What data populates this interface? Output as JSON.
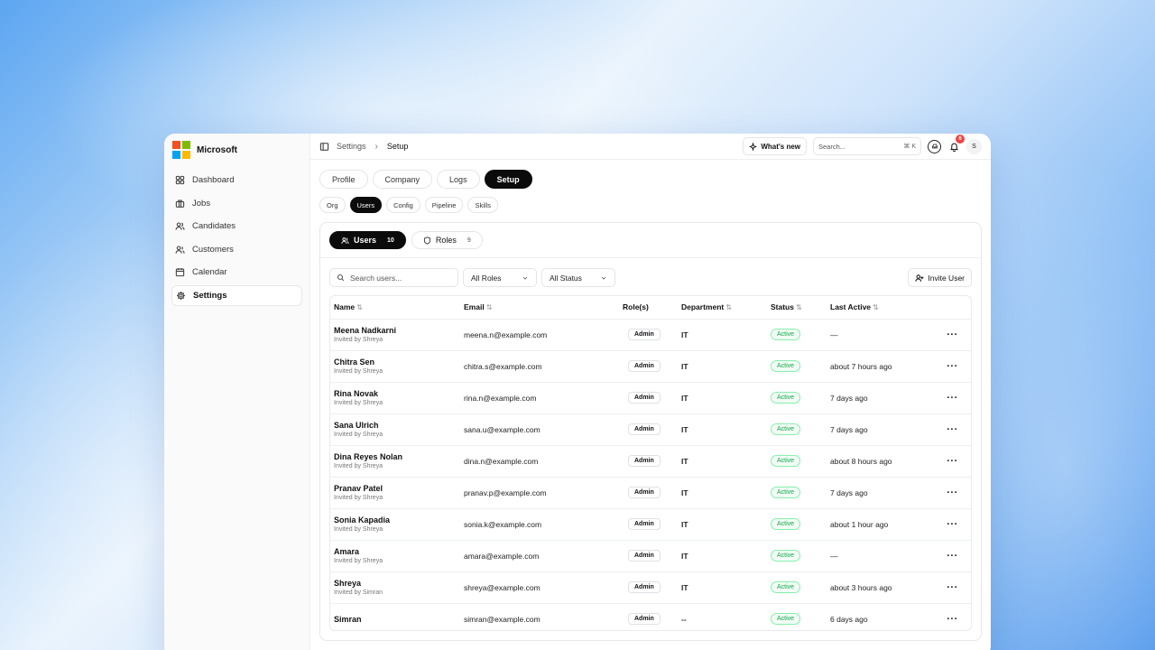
{
  "brand": {
    "name": "Microsoft",
    "logo_colors": [
      "#f25022",
      "#7fba00",
      "#00a4ef",
      "#ffb900"
    ]
  },
  "sidebar": {
    "items": [
      {
        "label": "Dashboard",
        "icon": "dashboard-icon",
        "active": false
      },
      {
        "label": "Jobs",
        "icon": "briefcase-icon",
        "active": false
      },
      {
        "label": "Candidates",
        "icon": "users-icon",
        "active": false
      },
      {
        "label": "Customers",
        "icon": "user-card-icon",
        "active": false
      },
      {
        "label": "Calendar",
        "icon": "calendar-icon",
        "active": false
      },
      {
        "label": "Settings",
        "icon": "gear-icon",
        "active": true
      }
    ]
  },
  "topbar": {
    "breadcrumb": [
      "Settings",
      "Setup"
    ],
    "whats_new": "What's new",
    "search_placeholder": "Search...",
    "search_shortcut": "⌘ K",
    "notification_count": "6",
    "avatar_initial": "S"
  },
  "tabs": [
    "Profile",
    "Company",
    "Logs",
    "Setup"
  ],
  "active_tab": "Setup",
  "subtabs": [
    "Org",
    "Users",
    "Config",
    "Pipeline",
    "Skills"
  ],
  "active_subtab": "Users",
  "panel": {
    "segments": [
      {
        "label": "Users",
        "count": "10",
        "icon": "users-icon",
        "active": true
      },
      {
        "label": "Roles",
        "count": "9",
        "icon": "shield-icon",
        "active": false
      }
    ],
    "search_placeholder": "Search users...",
    "role_filter": "All Roles",
    "status_filter": "All Status",
    "invite_label": "Invite User"
  },
  "table": {
    "columns": [
      "Name",
      "Email",
      "Role(s)",
      "Department",
      "Status",
      "Last Active"
    ],
    "rows": [
      {
        "name": "Meena Nadkarni",
        "invited": "Invited by Shreya",
        "email": "meena.n@example.com",
        "role": "Admin",
        "dept": "IT",
        "status": "Active",
        "last": "—"
      },
      {
        "name": "Chitra Sen",
        "invited": "Invited by Shreya",
        "email": "chitra.s@example.com",
        "role": "Admin",
        "dept": "IT",
        "status": "Active",
        "last": "about 7 hours ago"
      },
      {
        "name": "Rina Novak",
        "invited": "Invited by Shreya",
        "email": "rina.n@example.com",
        "role": "Admin",
        "dept": "IT",
        "status": "Active",
        "last": "7 days ago"
      },
      {
        "name": "Sana Ulrich",
        "invited": "Invited by Shreya",
        "email": "sana.u@example.com",
        "role": "Admin",
        "dept": "IT",
        "status": "Active",
        "last": "7 days ago"
      },
      {
        "name": "Dina Reyes Nolan",
        "invited": "Invited by Shreya",
        "email": "dina.n@example.com",
        "role": "Admin",
        "dept": "IT",
        "status": "Active",
        "last": "about 8 hours ago"
      },
      {
        "name": "Pranav Patel",
        "invited": "Invited by Shreya",
        "email": "pranav.p@example.com",
        "role": "Admin",
        "dept": "IT",
        "status": "Active",
        "last": "7 days ago"
      },
      {
        "name": "Sonia Kapadia",
        "invited": "Invited by Shreya",
        "email": "sonia.k@example.com",
        "role": "Admin",
        "dept": "IT",
        "status": "Active",
        "last": "about 1 hour ago"
      },
      {
        "name": "Amara",
        "invited": "Invited by Shreya",
        "email": "amara@example.com",
        "role": "Admin",
        "dept": "IT",
        "status": "Active",
        "last": "—"
      },
      {
        "name": "Shreya",
        "invited": "Invited by Simran",
        "email": "shreya@example.com",
        "role": "Admin",
        "dept": "IT",
        "status": "Active",
        "last": "about 3 hours ago"
      },
      {
        "name": "Simran",
        "invited": "",
        "email": "simran@example.com",
        "role": "Admin",
        "dept": "--",
        "status": "Active",
        "last": "6 days ago"
      }
    ]
  }
}
